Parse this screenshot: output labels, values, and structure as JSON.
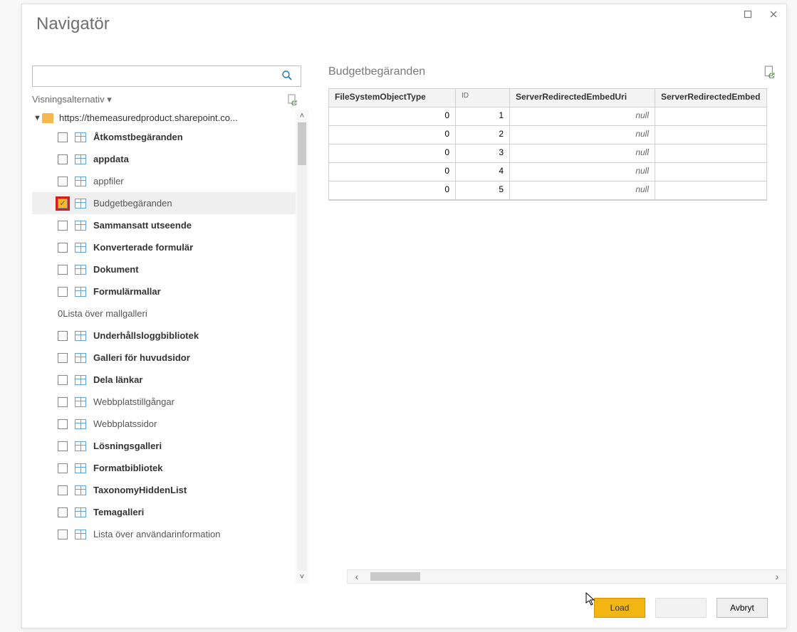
{
  "window": {
    "title": "Navigatör"
  },
  "search": {
    "value": "",
    "placeholder": ""
  },
  "view_options": {
    "label": "Visningsalternativ ▾"
  },
  "tree": {
    "root_label": "https://themeasuredproduct.sharepoint.co...",
    "items": [
      {
        "label": "Åtkomstbegäranden",
        "checked": false,
        "bold": true,
        "hasIcon": true
      },
      {
        "label": "appdata",
        "checked": false,
        "bold": true,
        "hasIcon": true
      },
      {
        "label": "appfiler",
        "checked": false,
        "bold": false,
        "hasIcon": true
      },
      {
        "label": "Budgetbegäranden",
        "checked": true,
        "bold": false,
        "hasIcon": true,
        "selected": true,
        "highlight": true
      },
      {
        "label": "Sammansatt utseende",
        "checked": false,
        "bold": true,
        "hasIcon": true
      },
      {
        "label": "Konverterade formulär",
        "checked": false,
        "bold": true,
        "hasIcon": true
      },
      {
        "label": "Dokument",
        "checked": false,
        "bold": true,
        "hasIcon": true
      },
      {
        "label": "Formulärmallar",
        "checked": false,
        "bold": true,
        "hasIcon": true
      },
      {
        "label": "0Lista över mallgalleri",
        "checked": false,
        "bold": false,
        "hasIcon": false
      },
      {
        "label": "Underhållsloggbibliotek",
        "checked": false,
        "bold": true,
        "hasIcon": true
      },
      {
        "label": "Galleri för huvudsidor",
        "checked": false,
        "bold": true,
        "hasIcon": true
      },
      {
        "label": "Dela länkar",
        "checked": false,
        "bold": true,
        "hasIcon": true
      },
      {
        "label": "Webbplatstillgångar",
        "checked": false,
        "bold": false,
        "hasIcon": true
      },
      {
        "label": "Webbplatssidor",
        "checked": false,
        "bold": false,
        "hasIcon": true
      },
      {
        "label": "Lösningsgalleri",
        "checked": false,
        "bold": true,
        "hasIcon": true
      },
      {
        "label": "Formatbibliotek",
        "checked": false,
        "bold": true,
        "hasIcon": true
      },
      {
        "label": "TaxonomyHiddenList",
        "checked": false,
        "bold": true,
        "hasIcon": true
      },
      {
        "label": "Temagalleri",
        "checked": false,
        "bold": true,
        "hasIcon": true
      },
      {
        "label": "Lista över användarinformation",
        "checked": false,
        "bold": false,
        "hasIcon": true
      }
    ]
  },
  "preview": {
    "title": "Budgetbegäranden",
    "columns": [
      "FileSystemObjectType",
      "ID",
      "ServerRedirectedEmbedUri",
      "ServerRedirectedEmbed"
    ],
    "rows": [
      {
        "c0": "0",
        "c1": "1",
        "c2": "null",
        "c3": ""
      },
      {
        "c0": "0",
        "c1": "2",
        "c2": "null",
        "c3": ""
      },
      {
        "c0": "0",
        "c1": "3",
        "c2": "null",
        "c3": ""
      },
      {
        "c0": "0",
        "c1": "4",
        "c2": "null",
        "c3": ""
      },
      {
        "c0": "0",
        "c1": "5",
        "c2": "null",
        "c3": ""
      }
    ]
  },
  "footer": {
    "load": "Load",
    "transform": "",
    "cancel": "Avbryt"
  }
}
